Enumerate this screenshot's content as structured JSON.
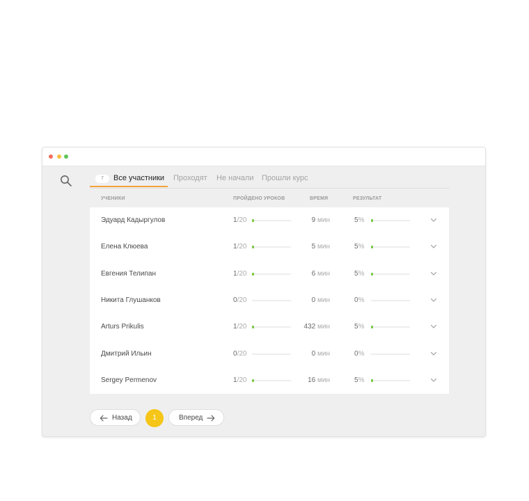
{
  "window": {
    "dot_colors": [
      "#f26d5b",
      "#f5c142",
      "#5fc55a"
    ]
  },
  "search": {
    "icon": "search-icon"
  },
  "tabs": [
    {
      "label": "Все участники",
      "badge": "7",
      "active": true
    },
    {
      "label": "Проходят",
      "active": false
    },
    {
      "label": "Не начали",
      "active": false
    },
    {
      "label": "Прошли курс",
      "active": false
    }
  ],
  "columns": {
    "students": "УЧЕНИКИ",
    "lessons": "ПРОЙДЕНО УРОКОВ",
    "time": "ВРЕМЯ",
    "result": "РЕЗУЛЬТАТ"
  },
  "rows": [
    {
      "name": "Эдуард Кадыргулов",
      "done": "1",
      "total": "/20",
      "progress": 0.05,
      "time": "9",
      "time_unit": "мин",
      "result": "5",
      "result_unit": "%",
      "result_progress": 0.05
    },
    {
      "name": "Елена Клюева",
      "done": "1",
      "total": "/20",
      "progress": 0.05,
      "time": "5",
      "time_unit": "мин",
      "result": "5",
      "result_unit": "%",
      "result_progress": 0.05
    },
    {
      "name": "Евгения Телипан",
      "done": "1",
      "total": "/20",
      "progress": 0.05,
      "time": "6",
      "time_unit": "мин",
      "result": "5",
      "result_unit": "%",
      "result_progress": 0.05
    },
    {
      "name": "Никита Глушанков",
      "done": "0",
      "total": "/20",
      "progress": 0,
      "time": "0",
      "time_unit": "мин",
      "result": "0",
      "result_unit": "%",
      "result_progress": 0
    },
    {
      "name": "Arturs Prikulis",
      "done": "1",
      "total": "/20",
      "progress": 0.05,
      "time": "432",
      "time_unit": "мин",
      "result": "5",
      "result_unit": "%",
      "result_progress": 0.05
    },
    {
      "name": "Дмитрий Ильин",
      "done": "0",
      "total": "/20",
      "progress": 0,
      "time": "0",
      "time_unit": "мин",
      "result": "0",
      "result_unit": "%",
      "result_progress": 0
    },
    {
      "name": "Sergey Permenov",
      "done": "1",
      "total": "/20",
      "progress": 0.05,
      "time": "16",
      "time_unit": "мин",
      "result": "5",
      "result_unit": "%",
      "result_progress": 0.05
    }
  ],
  "pagination": {
    "prev_label": "Назад",
    "current_page": "1",
    "next_label": "Вперед"
  },
  "colors": {
    "accent_tab": "#f2a33a",
    "progress": "#7ac943",
    "page_active": "#f5c518"
  }
}
